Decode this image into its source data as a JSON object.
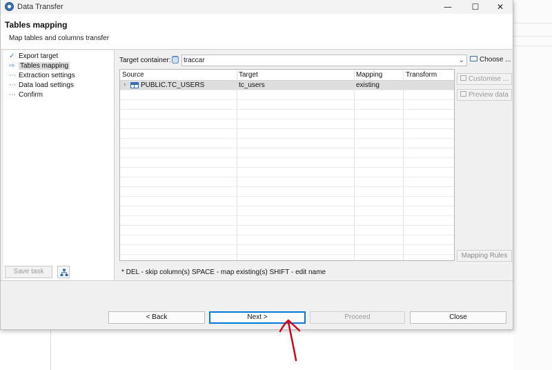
{
  "window": {
    "title": "Data Transfer",
    "minimize": "—",
    "maximize": "☐",
    "close": "✕",
    "icon": "app-icon"
  },
  "header": {
    "title": "Tables mapping",
    "subtitle": "Map tables and columns transfer"
  },
  "nav": {
    "items": [
      {
        "label": "Export target",
        "icon": "check-icon",
        "glyph": "✓",
        "active": false
      },
      {
        "label": "Tables mapping",
        "icon": "arrow-right-icon",
        "glyph": "⇨",
        "active": true
      },
      {
        "label": "Extraction settings",
        "icon": "dots-icon",
        "glyph": "⋯",
        "active": false
      },
      {
        "label": "Data load settings",
        "icon": "dots-icon",
        "glyph": "⋯",
        "active": false
      },
      {
        "label": "Confirm",
        "icon": "dots-icon",
        "glyph": "⋯",
        "active": false
      }
    ],
    "save_task": "Save task"
  },
  "main": {
    "target_container_label": "Target container:",
    "target_container_value": "traccar",
    "choose_label": "Choose ...",
    "columns": [
      "Source",
      "Target",
      "Mapping",
      "Transform"
    ],
    "rows": [
      {
        "source": "PUBLIC.TC_USERS",
        "target": "tc_users",
        "mapping": "existing",
        "transform": ""
      }
    ],
    "customise_label": "Customise ...",
    "preview_label": "Preview data",
    "mapping_rules_label": "Mapping Rules",
    "hint": "* DEL - skip column(s)  SPACE - map existing(s)  SHIFT - edit name"
  },
  "footer": {
    "back": "< Back",
    "next": "Next >",
    "proceed": "Proceed",
    "close": "Close"
  },
  "colors": {
    "accent": "#0078d4",
    "annotation": "#d0021b",
    "selected_row": "#dedede"
  }
}
